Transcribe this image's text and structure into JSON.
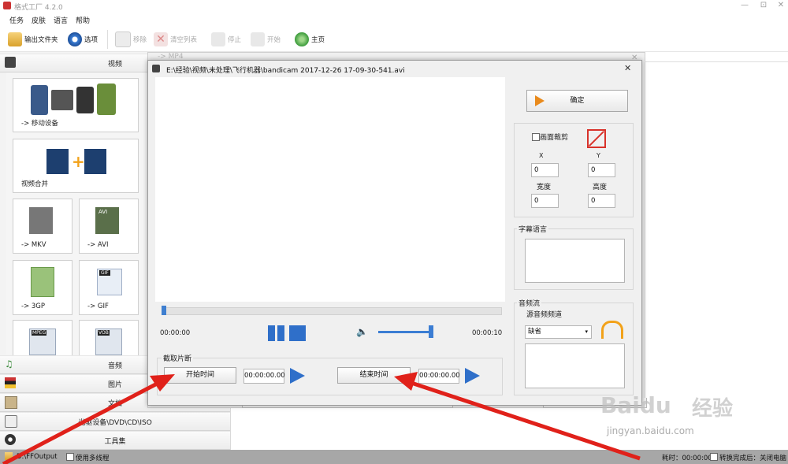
{
  "app": {
    "title": "格式工厂 4.2.0",
    "minimize": "—",
    "maximize": "⊡",
    "close": "✕"
  },
  "menu": [
    "任务",
    "皮肤",
    "语言",
    "帮助"
  ],
  "toolbar": {
    "output_folder": "输出文件夹",
    "options": "选项",
    "remove": "移除",
    "clear_list": "清空列表",
    "stop": "停止",
    "start": "开始",
    "home": "主页"
  },
  "sidebar": {
    "video_header": "视频",
    "tiles": [
      "-> 移动设备",
      "视频合并",
      "-> MKV",
      "-> AVI",
      "-> 3GP",
      "-> GIF"
    ],
    "tile_badges": [
      "AVI",
      "GIF",
      "MPEG",
      "VOB"
    ],
    "categories": [
      "音频",
      "图片",
      "文档",
      "光驱设备\\DVD\\CD\\ISO",
      "工具集"
    ]
  },
  "bg_window": {
    "title": "-> MP4"
  },
  "dialog": {
    "path": "E:\\经验\\视频\\未处理\\飞行机器\\bandicam 2017-12-26 17-09-30-541.avi",
    "confirm": "确定",
    "time_start": "00:00:00",
    "time_end": "00:00:10",
    "crop": {
      "label": "画面裁剪",
      "x_label": "X",
      "y_label": "Y",
      "x": "0",
      "y": "0",
      "width_label": "宽度",
      "height_label": "高度",
      "width": "0",
      "height": "0"
    },
    "subtitle_label": "字幕语言",
    "audio": {
      "label": "音频流",
      "source_label": "源音频频道",
      "selected": "缺省"
    },
    "clip": {
      "label": "截取片断",
      "start_btn": "开始时间",
      "start_value": "00:00:00.00",
      "end_btn": "结束时间",
      "end_value": "00:00:00.00"
    }
  },
  "status": {
    "path": "D:\\FFOutput",
    "multithread": "使用多线程",
    "elapsed": "耗时：00:00:00",
    "after": "转换完成后：关闭电脑"
  },
  "watermark": {
    "brand": "Baidu",
    "cn": "经验",
    "url": "jingyan.baidu.com"
  },
  "colors": {
    "accent_blue": "#2f6fc9",
    "arrow_red": "#e0211a",
    "statusbar": "#a7a7a7"
  }
}
